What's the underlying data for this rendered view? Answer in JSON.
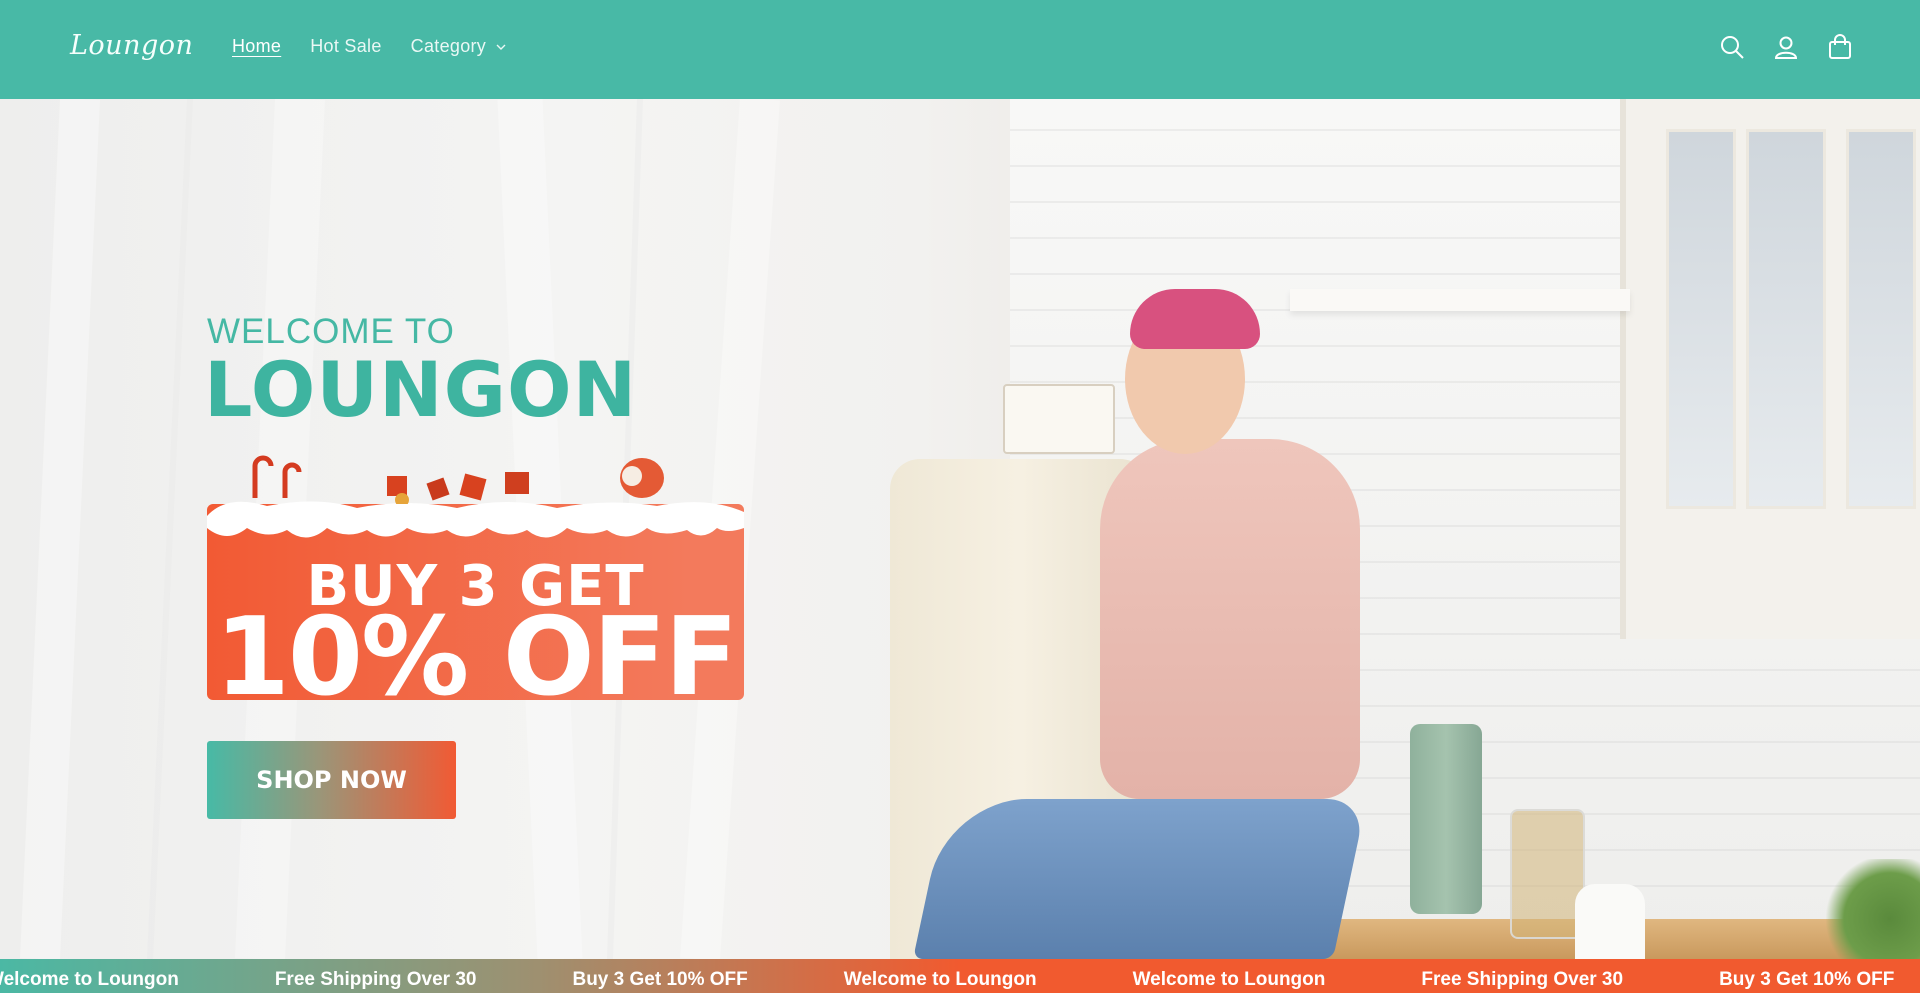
{
  "header": {
    "logo_text": "Loungon",
    "nav": [
      {
        "label": "Home",
        "prefix": "",
        "active": true
      },
      {
        "label": "Hot Sale",
        "active": false
      },
      {
        "label": "Category",
        "active": false,
        "has_dropdown": true
      }
    ],
    "icons": [
      "search-icon",
      "account-icon",
      "cart-icon"
    ]
  },
  "hero": {
    "welcome": "WELCOME TO",
    "brand": "LOUNGON",
    "promo_line1": "BUY 3 GET",
    "promo_line2": "10% OFF",
    "cta": "SHOP NOW"
  },
  "ticker": {
    "items": [
      "Welcome to Loungon",
      "Free Shipping Over 30",
      "Buy 3 Get 10% OFF",
      "Welcome to Loungon",
      "Welcome to Loungon",
      "Free Shipping Over 30",
      "Buy 3 Get 10% OFF"
    ]
  },
  "colors": {
    "header_bg": "#48b9a6",
    "brand_teal": "#3eb4a0",
    "promo_orange": "#f25a34"
  }
}
